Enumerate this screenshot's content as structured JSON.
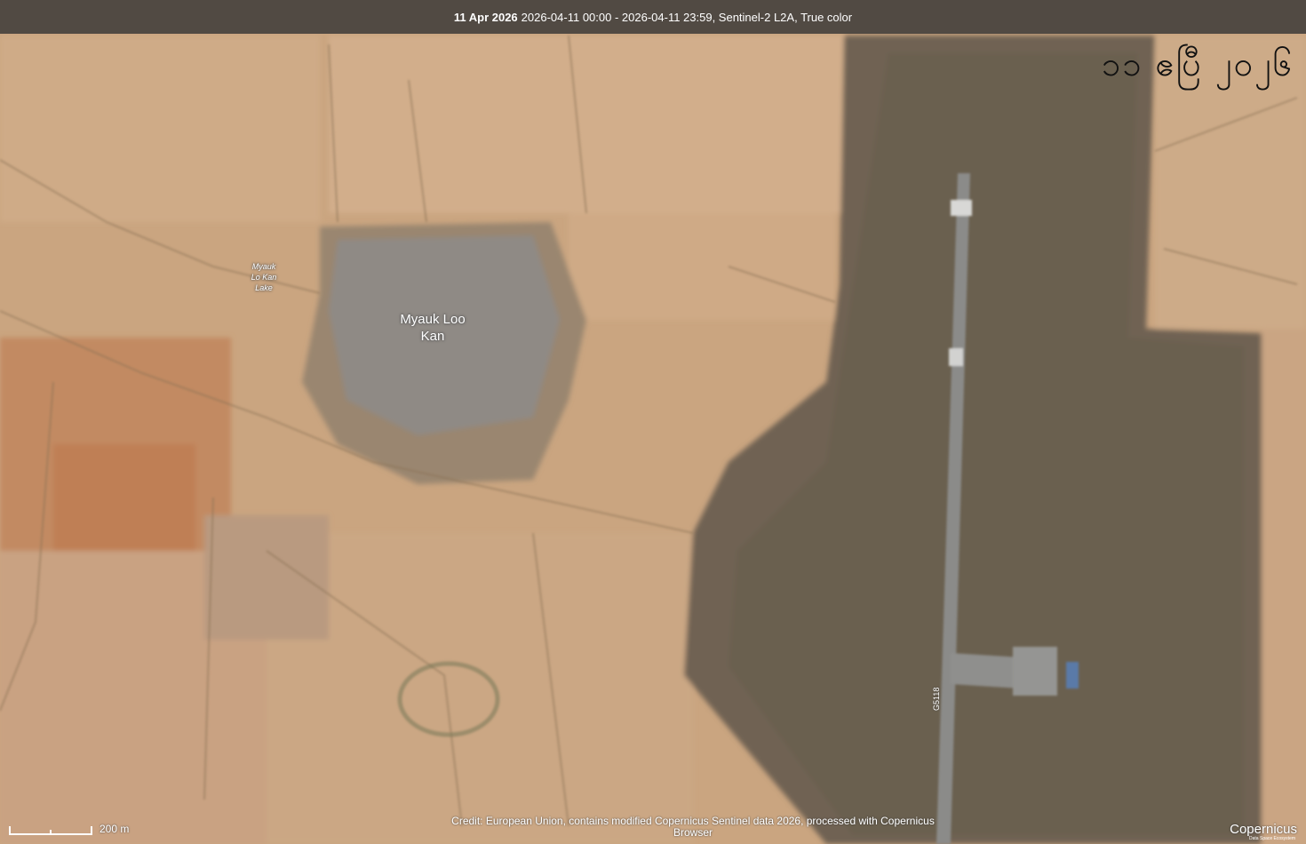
{
  "header": {
    "date": "11 Apr 2026",
    "range": "2026-04-11 00:00 - 2026-04-11 23:59, Sentinel-2 L2A, True color"
  },
  "overlay": {
    "text": "၁၁ ဧပြီ ၂၀၂၆"
  },
  "labels": {
    "village": "Myauk Loo\nKan",
    "lake": "Myauk\nLo Kan\nLake",
    "road": "G5118"
  },
  "scale": {
    "label": "200 m"
  },
  "credit": {
    "text": "Credit: European Union, contains modified Copernicus Sentinel data 2026, processed with Copernicus Browser"
  },
  "brand": {
    "name": "Copernicus",
    "tagline": "Data Space Ecosystem"
  },
  "colors": {
    "farmland": "#c9a47e",
    "scrub": "#6e6052",
    "runway": "#8a8a88",
    "bar": "#46423e"
  }
}
